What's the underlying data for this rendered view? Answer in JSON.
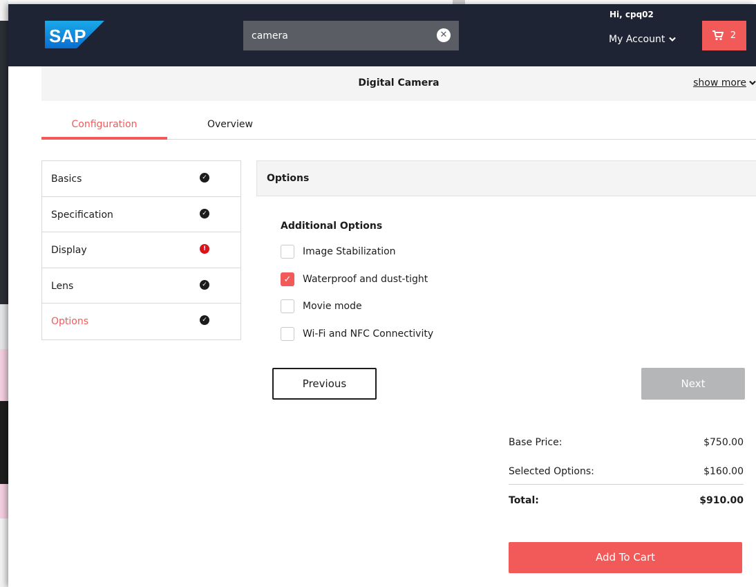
{
  "header": {
    "logo_text": "SAP",
    "search": {
      "value": "camera"
    },
    "greeting": "Hi, cpq02",
    "account_label": "My Account",
    "cart_count": "2"
  },
  "product": {
    "title": "Digital Camera",
    "show_more_label": "show more"
  },
  "tabs": {
    "configuration": "Configuration",
    "overview": "Overview"
  },
  "steps": [
    {
      "label": "Basics",
      "status": "complete"
    },
    {
      "label": "Specification",
      "status": "complete"
    },
    {
      "label": "Display",
      "status": "error"
    },
    {
      "label": "Lens",
      "status": "complete"
    },
    {
      "label": "Options",
      "status": "complete",
      "active": true
    }
  ],
  "options": {
    "section_title": "Options",
    "group_title": "Additional Options",
    "items": [
      {
        "label": "Image Stabilization",
        "checked": false
      },
      {
        "label": "Waterproof and dust-tight",
        "checked": true
      },
      {
        "label": "Movie mode",
        "checked": false
      },
      {
        "label": "Wi-Fi and NFC Connectivity",
        "checked": false
      }
    ]
  },
  "nav": {
    "previous_label": "Previous",
    "next_label": "Next"
  },
  "pricing": {
    "base_label": "Base Price:",
    "base_value": "$750.00",
    "selected_label": "Selected Options:",
    "selected_value": "$160.00",
    "total_label": "Total:",
    "total_value": "$910.00"
  },
  "add_to_cart_label": "Add To Cart",
  "colors": {
    "accent": "#f25a5a",
    "header_bg": "#1f2434",
    "error": "#d9141c",
    "disabled": "#b5b6b8"
  }
}
